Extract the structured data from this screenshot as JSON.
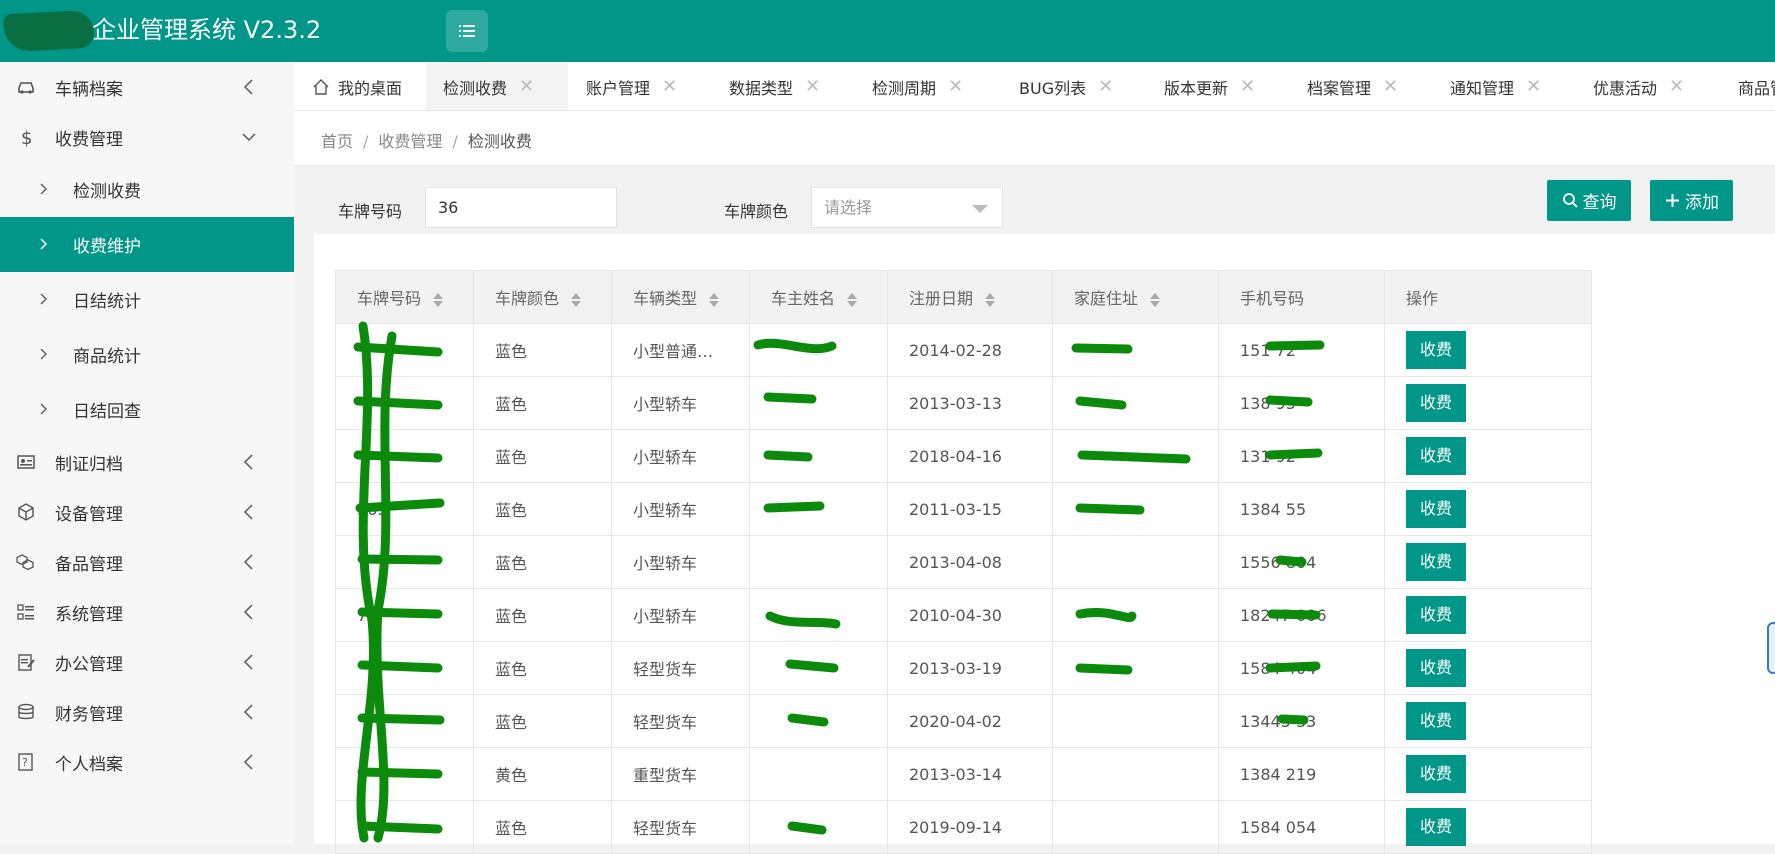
{
  "header": {
    "title": "企业管理系统 V2.3.2",
    "menu_icon": "hamburger-icon",
    "brand_color": "#009688"
  },
  "sidebar": {
    "items": [
      {
        "label": "车辆档案",
        "icon": "car-icon"
      },
      {
        "label": "收费管理",
        "icon": "dollar-icon"
      },
      {
        "label": "制证归档",
        "icon": "id-card-icon"
      },
      {
        "label": "设备管理",
        "icon": "cube-icon"
      },
      {
        "label": "备品管理",
        "icon": "cubes-icon"
      },
      {
        "label": "系统管理",
        "icon": "list-grid-icon"
      },
      {
        "label": "办公管理",
        "icon": "edit-icon"
      },
      {
        "label": "财务管理",
        "icon": "database-icon"
      },
      {
        "label": "个人档案",
        "icon": "help-doc-icon"
      }
    ],
    "sub_items": [
      {
        "label": "检测收费"
      },
      {
        "label": "收费维护"
      },
      {
        "label": "日结统计"
      },
      {
        "label": "商品统计"
      },
      {
        "label": "日结回查"
      }
    ]
  },
  "tabs": [
    {
      "label": "我的桌面"
    },
    {
      "label": "检测收费"
    },
    {
      "label": "账户管理"
    },
    {
      "label": "数据类型"
    },
    {
      "label": "检测周期"
    },
    {
      "label": "BUG列表"
    },
    {
      "label": "版本更新"
    },
    {
      "label": "档案管理"
    },
    {
      "label": "通知管理"
    },
    {
      "label": "优惠活动"
    },
    {
      "label": "商品管"
    }
  ],
  "tab_close_glyph": "✕",
  "breadcrumb": {
    "items": [
      "首页",
      "收费管理",
      "检测收费"
    ],
    "sep": "/"
  },
  "filter": {
    "plate_label": "车牌号码",
    "plate_value": "36",
    "color_label": "车牌颜色",
    "color_placeholder": "请选择",
    "search_label": "查询",
    "add_label": "添加"
  },
  "table": {
    "columns": [
      "车牌号码",
      "车牌颜色",
      "车辆类型",
      "车主姓名",
      "注册日期",
      "家庭住址",
      "手机号码",
      "操作"
    ],
    "action_label": "收费",
    "rows": [
      {
        "plate": "",
        "color": "蓝色",
        "type": "小型普通…",
        "owner": "",
        "date": "2014-02-28",
        "address": "",
        "phone": "151  72"
      },
      {
        "plate": "",
        "color": "蓝色",
        "type": "小型轿车",
        "owner": "",
        "date": "2013-03-13",
        "address": "",
        "phone": "138  95"
      },
      {
        "plate": "",
        "color": "蓝色",
        "type": "小型轿车",
        "owner": "",
        "date": "2018-04-16",
        "address": "",
        "phone": "131  92"
      },
      {
        "plate": "363",
        "color": "蓝色",
        "type": "小型轿车",
        "owner": "",
        "date": "2011-03-15",
        "address": "",
        "phone": "1384  55"
      },
      {
        "plate": "",
        "color": "蓝色",
        "type": "小型轿车",
        "owner": "",
        "date": "2013-04-08",
        "address": "",
        "phone": "1556  804"
      },
      {
        "plate": "7A",
        "color": "蓝色",
        "type": "小型轿车",
        "owner": "",
        "date": "2010-04-30",
        "address": "",
        "phone": "18247  006"
      },
      {
        "plate": "",
        "color": "蓝色",
        "type": "轻型货车",
        "owner": "",
        "date": "2013-03-19",
        "address": "",
        "phone": "1584  404"
      },
      {
        "plate": "",
        "color": "蓝色",
        "type": "轻型货车",
        "owner": "",
        "date": "2020-04-02",
        "address": "",
        "phone": "13445  33"
      },
      {
        "plate": "",
        "color": "黄色",
        "type": "重型货车",
        "owner": "",
        "date": "2013-03-14",
        "address": "",
        "phone": "1384  219"
      },
      {
        "plate": "",
        "color": "蓝色",
        "type": "轻型货车",
        "owner": "",
        "date": "2019-09-14",
        "address": "",
        "phone": "1584  054"
      }
    ]
  },
  "redaction_color": "#0b8a0b"
}
